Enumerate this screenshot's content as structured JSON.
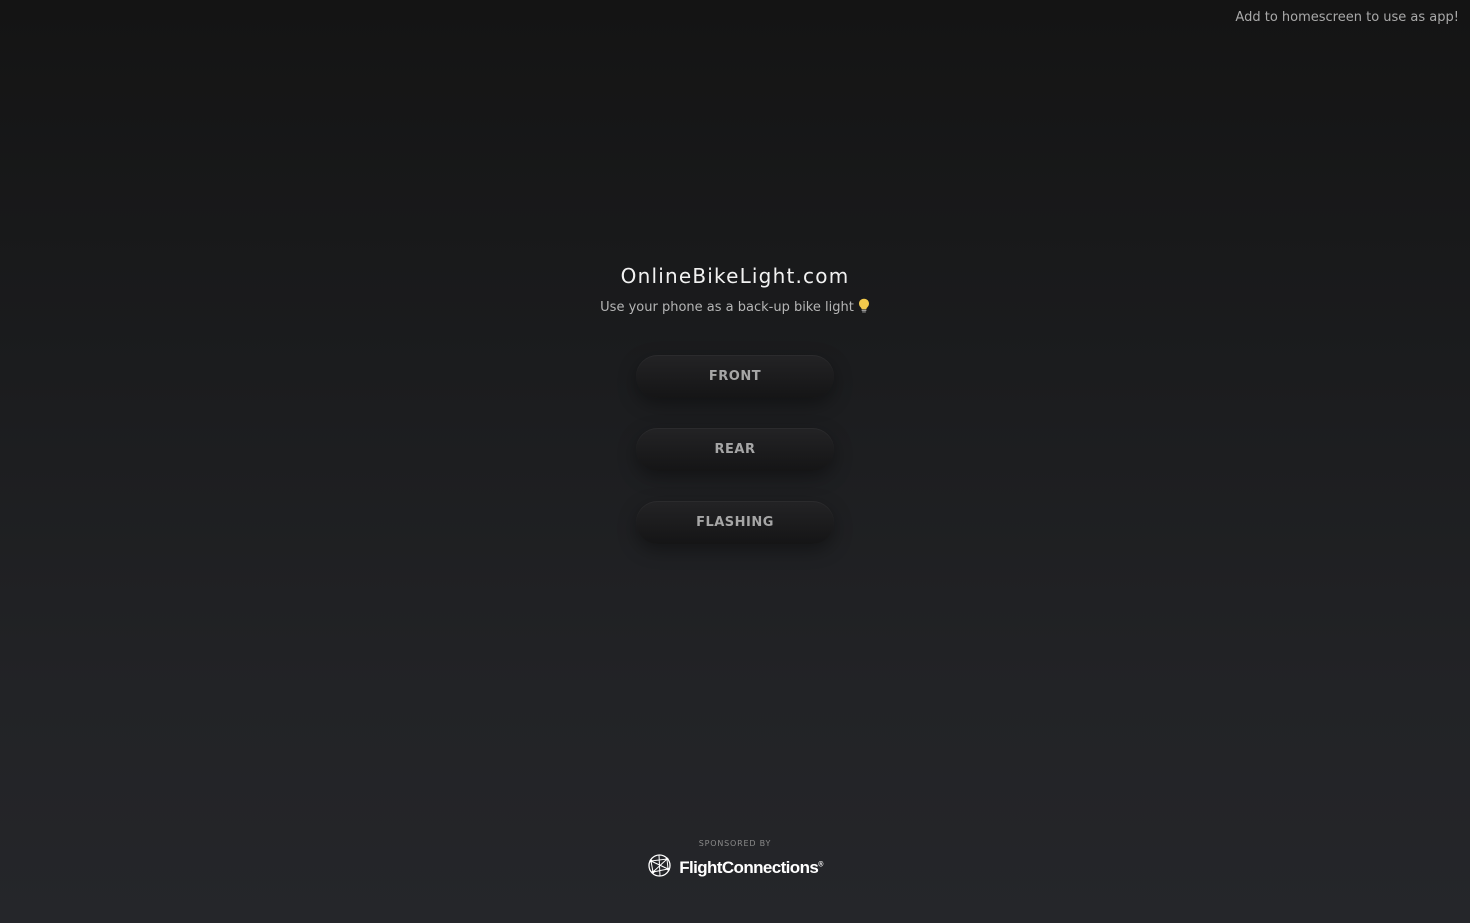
{
  "header": {
    "add_to_homescreen": "Add to homescreen to use as app!"
  },
  "hero": {
    "title": "OnlineBikeLight.com",
    "tagline": "Use your phone as a back-up bike light"
  },
  "modes": [
    {
      "label": "FRONT"
    },
    {
      "label": "REAR"
    },
    {
      "label": "FLASHING"
    }
  ],
  "sponsor": {
    "label": "SPONSORED BY",
    "name": "FlightConnections",
    "trademark": "®",
    "icon": "globe-network-icon"
  },
  "icons": {
    "tagline_icon": "lightbulb-icon"
  },
  "colors": {
    "background_top": "#141414",
    "background_bottom": "#25262a",
    "button_bg": "#1c1c1e",
    "button_text": "#a6a6a6",
    "bulb": "#f2c94c"
  }
}
